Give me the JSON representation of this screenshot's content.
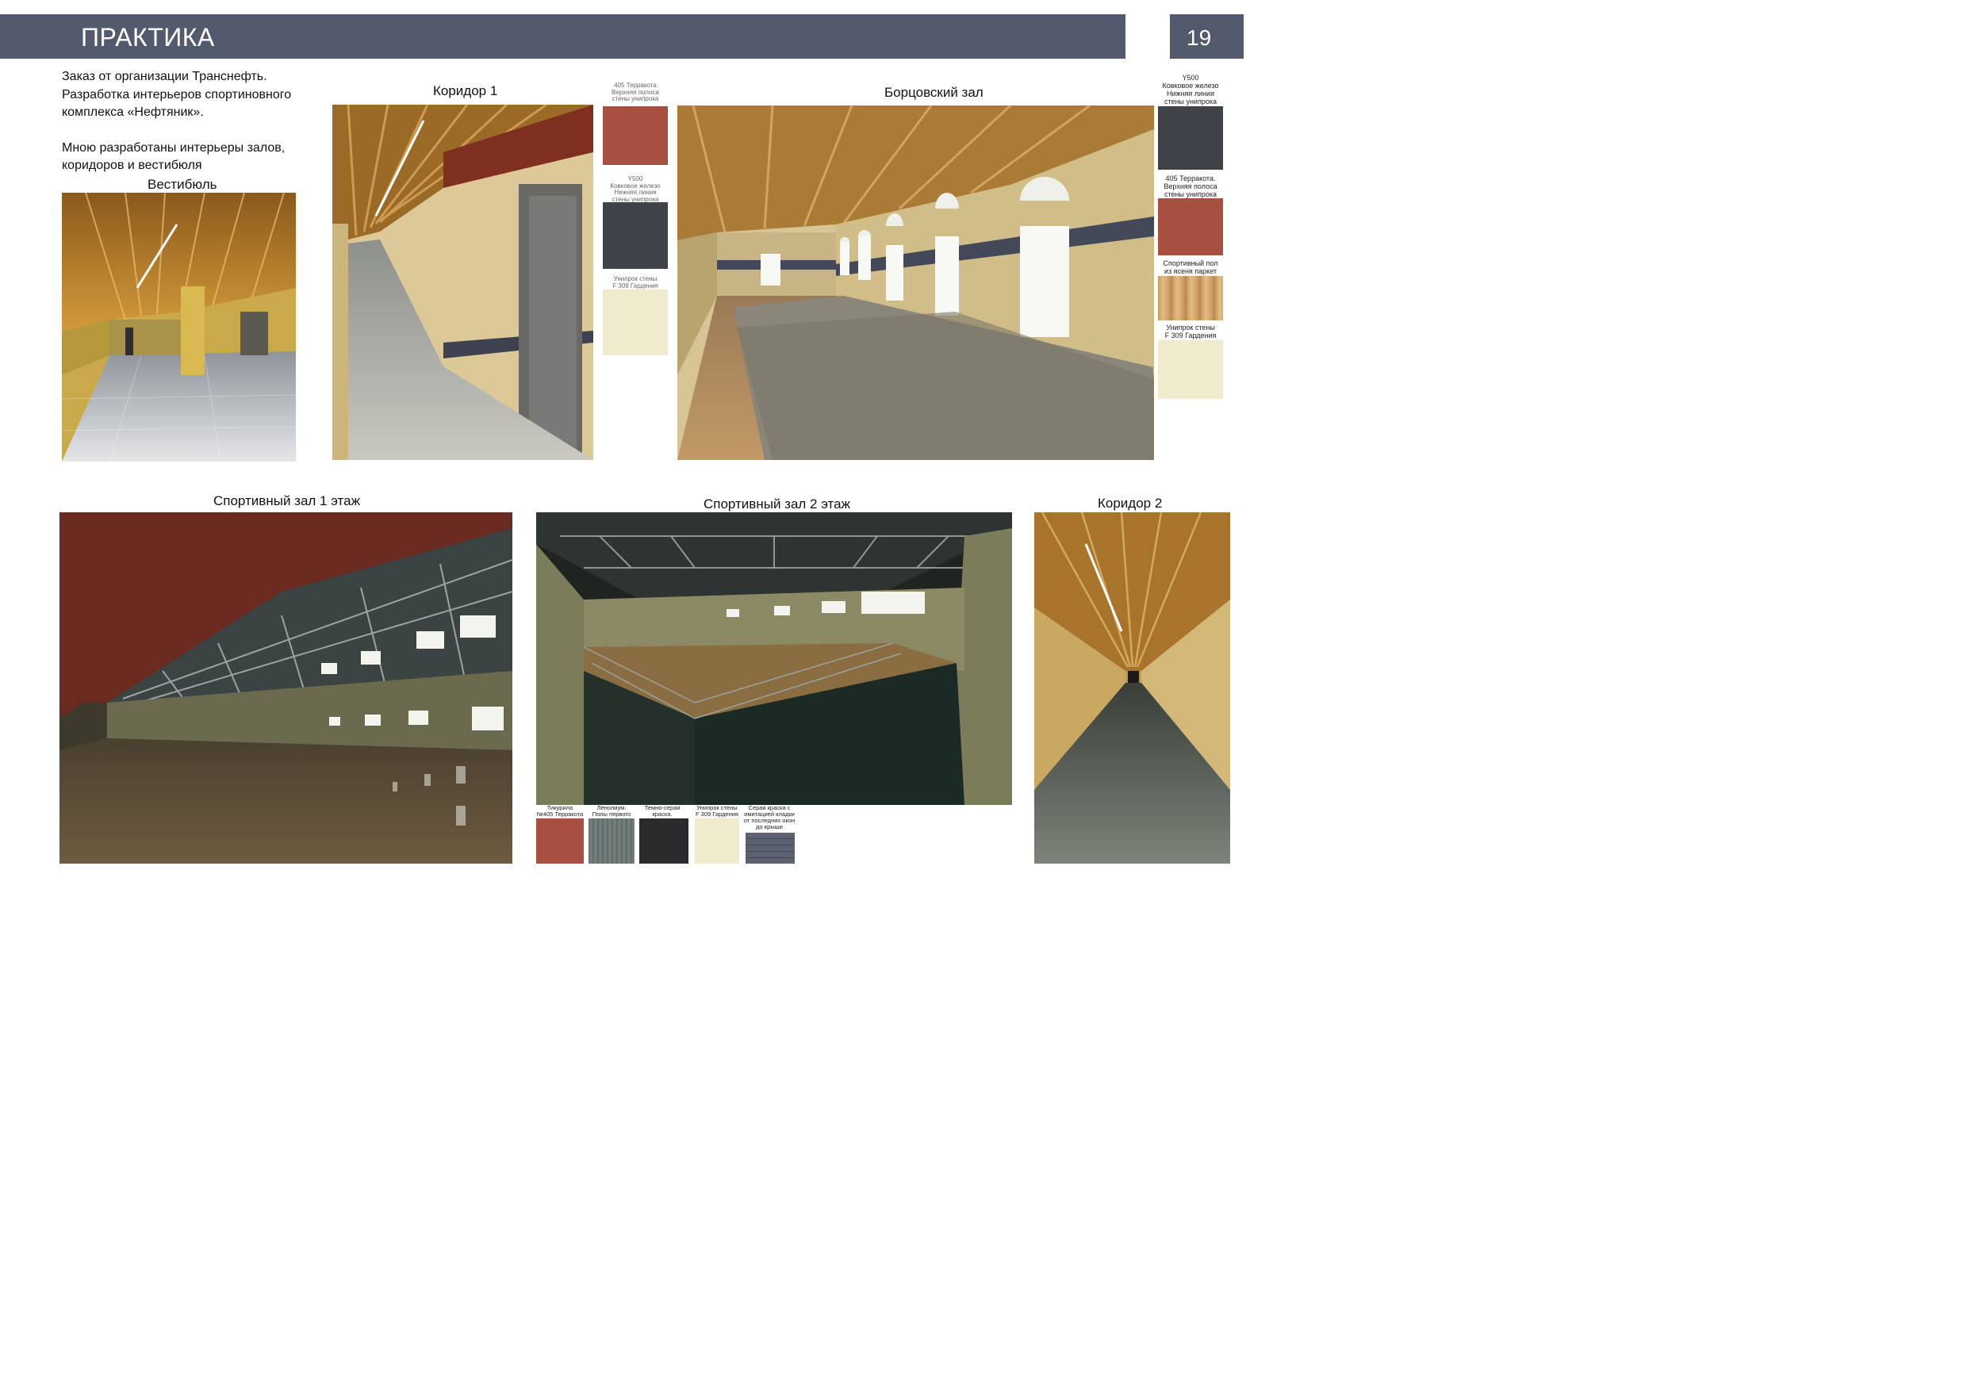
{
  "header": {
    "title": "ПРАКТИКА",
    "page_number": "19"
  },
  "intro": {
    "line1": "Заказ от организации Транснефть.",
    "line2": "Разработка интерьеров спортиновного",
    "line3": "комплекса «Нефтяник».",
    "line4": "Мною разработаны интерьеры залов,",
    "line5": "коридоров и вестибюля"
  },
  "captions": {
    "vestibule": "Вестибюль",
    "corridor1": "Коридор 1",
    "wrestling": "Борцовский зал",
    "sport1": "Спортивный зал 1 этаж",
    "sport2": "Спортивный зал 2 этаж",
    "corridor2": "Коридор 2"
  },
  "corridor1_swatches": [
    {
      "label": "405 Терракота\nВерхняя полоса\nстены унипрока",
      "color": "#a8503f"
    },
    {
      "label": "Y500\nКовковое железо\nНижняя линия\nстены унипрока",
      "color": "#3f4349"
    },
    {
      "label": "Унипрок стены\nF 309 Гардения",
      "color": "#f1ebce"
    }
  ],
  "wrestling_swatches": [
    {
      "label": "Y500\nКовковое железо\nНижняя линия\nстены унипрока",
      "color": "#3f4349"
    },
    {
      "label": "405 Терракота.\nВерхняя полоса\nстены унипрока",
      "color": "#a8503f"
    },
    {
      "label": "Спортивный пол\nиз ясеня паркет",
      "color": "#d2a66d"
    },
    {
      "label": "Унипрок стены\nF 309 Гардения",
      "color": "#f1ebce"
    }
  ],
  "sport2_swatches": [
    {
      "label": "Тикурила\n№405 Терракота",
      "color": "#a8503f"
    },
    {
      "label": "Ленолиум.\nПолы первого этажа",
      "color": "#697371"
    },
    {
      "label": "Темно-серая краска.\nПотолок зала",
      "color": "#2a2a2c"
    },
    {
      "label": "Унипрок стены\nF 309 Гардения",
      "color": "#f1ebce"
    },
    {
      "label": "Серая краска с\nимитацией кладки\nот последних окон\nдо крыши",
      "color": "#5b6170"
    }
  ]
}
